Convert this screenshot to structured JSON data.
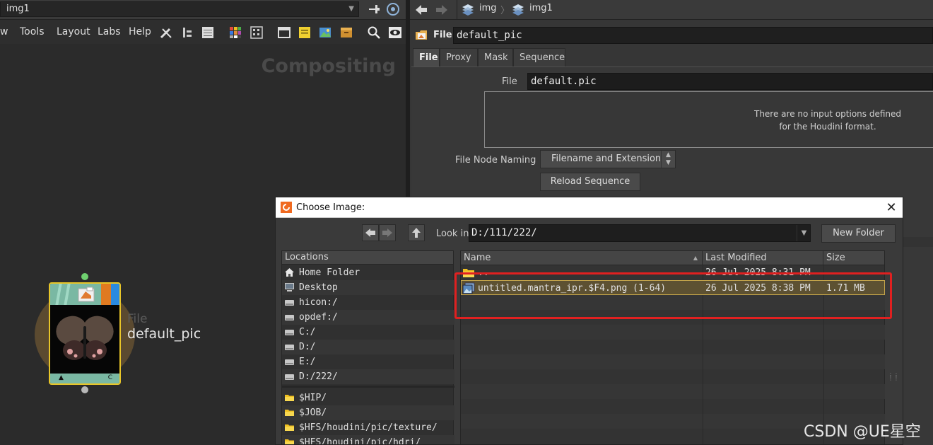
{
  "network": {
    "path": "img1",
    "menu": [
      "w",
      "Tools",
      "Layout",
      "Labs",
      "Help"
    ],
    "context_label": "Compositing",
    "node": {
      "type_label": "File",
      "name": "default_pic",
      "footer_left": "▲",
      "footer_right": "C"
    }
  },
  "params": {
    "breadcrumbs": [
      "img",
      "img1"
    ],
    "node_type_label": "File",
    "node_name": "default_pic",
    "tabs": [
      "File",
      "Proxy",
      "Mask",
      "Sequence"
    ],
    "active_tab": "File",
    "file_label": "File",
    "file_value": "default.pic",
    "no_options_line1": "There are no input options defined",
    "no_options_line2": "for the Houdini format.",
    "naming_label": "File Node Naming",
    "naming_value": "Filename and Extension",
    "reload_label": "Reload Sequence"
  },
  "dialog": {
    "title": "Choose Image:",
    "close": "✕",
    "look_in_label": "Look in",
    "look_in_value": "D:/111/222/",
    "new_folder_label": "New Folder",
    "locations_header": "Locations",
    "locations": [
      {
        "label": "Home Folder",
        "icon": "home-icon"
      },
      {
        "label": "Desktop",
        "icon": "desktop-icon"
      },
      {
        "label": "hicon:/",
        "icon": "drive-icon"
      },
      {
        "label": "opdef:/",
        "icon": "drive-icon"
      },
      {
        "label": "C:/",
        "icon": "drive-icon"
      },
      {
        "label": "D:/",
        "icon": "drive-icon"
      },
      {
        "label": "E:/",
        "icon": "drive-icon"
      },
      {
        "label": "D:/222/",
        "icon": "drive-icon"
      }
    ],
    "bookmarks": [
      {
        "label": "$HIP/",
        "icon": "folder-icon"
      },
      {
        "label": "$JOB/",
        "icon": "folder-icon"
      },
      {
        "label": "$HFS/houdini/pic/texture/",
        "icon": "folder-icon"
      },
      {
        "label": "$HFS/houdini/pic/hdri/",
        "icon": "folder-icon"
      }
    ],
    "columns": [
      "Name",
      "Last Modified",
      "Size"
    ],
    "files": [
      {
        "name": "..",
        "modified": "26 Jul 2025  8:31 PM",
        "size": "",
        "icon": "folder-icon"
      },
      {
        "name": "untitled.mantra_ipr.$F4.png (1-64)",
        "modified": "26 Jul 2025  8:38 PM",
        "size": "1.71 MB",
        "icon": "image-sequence-icon"
      }
    ]
  },
  "watermark": "CSDN @UE星空"
}
